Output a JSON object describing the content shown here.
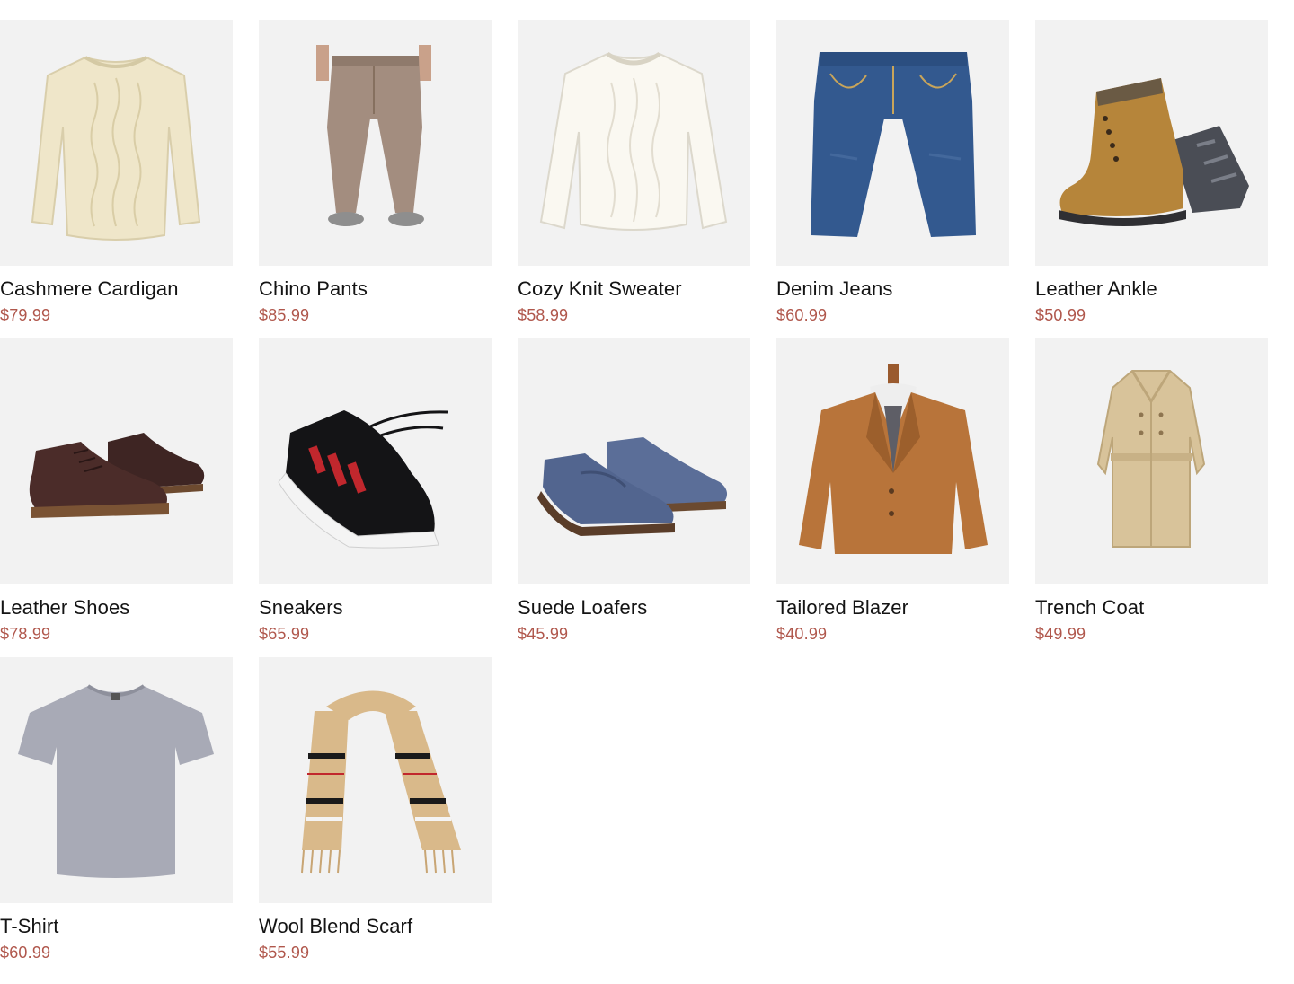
{
  "products": [
    {
      "name": "Cashmere Cardigan",
      "price": "$79.99",
      "icon": "sweater-image"
    },
    {
      "name": "Chino Pants",
      "price": "$85.99",
      "icon": "pants-image"
    },
    {
      "name": "Cozy Knit Sweater",
      "price": "$58.99",
      "icon": "sweater-image"
    },
    {
      "name": "Denim Jeans",
      "price": "$60.99",
      "icon": "jeans-image"
    },
    {
      "name": "Leather Ankle",
      "price": "$50.99",
      "icon": "boot-image"
    },
    {
      "name": "Leather Shoes",
      "price": "$78.99",
      "icon": "shoes-image"
    },
    {
      "name": "Sneakers",
      "price": "$65.99",
      "icon": "sneaker-image"
    },
    {
      "name": "Suede Loafers",
      "price": "$45.99",
      "icon": "loafer-image"
    },
    {
      "name": "Tailored Blazer",
      "price": "$40.99",
      "icon": "blazer-image"
    },
    {
      "name": "Trench Coat",
      "price": "$49.99",
      "icon": "coat-image"
    },
    {
      "name": "T-Shirt",
      "price": "$60.99",
      "icon": "tshirt-image"
    },
    {
      "name": "Wool Blend Scarf",
      "price": "$55.99",
      "icon": "scarf-image"
    }
  ],
  "colors": {
    "thumb_bg": "#f2f2f2",
    "price": "#b0574c",
    "name": "#141414"
  }
}
